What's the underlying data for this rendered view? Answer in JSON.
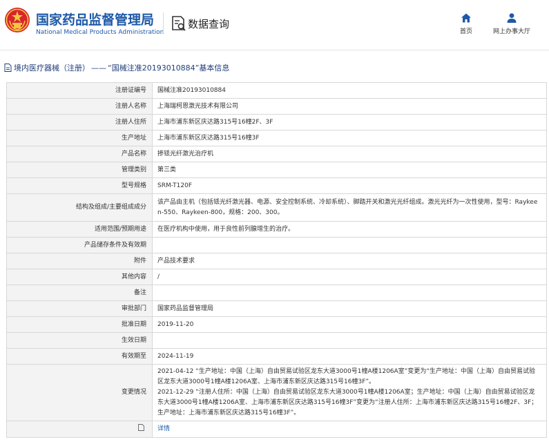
{
  "header": {
    "brand_cn": "国家药品监督管理局",
    "brand_en": "National Medical Products Administration",
    "query_label": "数据查询",
    "nav": [
      {
        "label": "首页",
        "icon": "home-icon"
      },
      {
        "label": "网上办事大厅",
        "icon": "user-icon"
      }
    ]
  },
  "breadcrumb": {
    "section": "境内医疗器械（注册）",
    "separator": "——",
    "record": "“国械注准20193010884”基本信息"
  },
  "fields": [
    {
      "label": "注册证编号",
      "value": "国械注准20193010884"
    },
    {
      "label": "注册人名称",
      "value": "上海瑞柯恩激光技术有限公司"
    },
    {
      "label": "注册人住所",
      "value": "上海市浦东新区庆达路315号16幢2F、3F"
    },
    {
      "label": "生产地址",
      "value": "上海市浦东新区庆达路315号16幢3F"
    },
    {
      "label": "产品名称",
      "value": "掺铥光纤激光治疗机"
    },
    {
      "label": "管理类别",
      "value": "第三类"
    },
    {
      "label": "型号规格",
      "value": "SRM-T120F"
    },
    {
      "label": "结构及组成/主要组成成分",
      "value": "该产品由主机（包括铥光纤激光器、电源、安全控制系统、冷却系统）、脚踏开关和激光光纤组成。激光光纤为一次性使用，型号：Raykeen-550、Raykeen-800，规格：200、300。"
    },
    {
      "label": "适用范围/预期用途",
      "value": "在医疗机构中使用，用于良性前列腺增生的治疗。"
    },
    {
      "label": "产品储存条件及有效期",
      "value": ""
    },
    {
      "label": "附件",
      "value": "产品技术要求"
    },
    {
      "label": "其他内容",
      "value": "/"
    },
    {
      "label": "备注",
      "value": ""
    },
    {
      "label": "审批部门",
      "value": "国家药品监督管理局"
    },
    {
      "label": "批准日期",
      "value": "2019-11-20"
    },
    {
      "label": "生效日期",
      "value": ""
    },
    {
      "label": "有效期至",
      "value": "2024-11-19"
    }
  ],
  "changes": {
    "label": "变更情况",
    "entries": [
      "2021-04-12 “生产地址：中国（上海）自由贸易试验区龙东大道3000号1幢A楼1206A室”变更为“生产地址：中国（上海）自由贸易试验区龙东大道3000号1幢A楼1206A室、上海市浦东新区庆达路315号16幢3F”。",
      "2021-12-29 “注册人住所：中国（上海）自由贸易试验区龙东大道3000号1幢A楼1206A室；生产地址：中国（上海）自由贸易试验区龙东大道3000号1幢A楼1206A室、上海市浦东新区庆达路315号16幢3F”变更为“注册人住所：上海市浦东新区庆达路315号16幢2F、3F；生产地址：上海市浦东新区庆达路315号16幢3F”。"
    ]
  },
  "detail_row": {
    "label": "",
    "link": "详情"
  },
  "colors": {
    "brand_blue": "#1e59a8",
    "breadcrumb_blue": "#1e3c7a",
    "key_cell_bg": "#f3f3f3",
    "border": "#d7d7d7"
  }
}
